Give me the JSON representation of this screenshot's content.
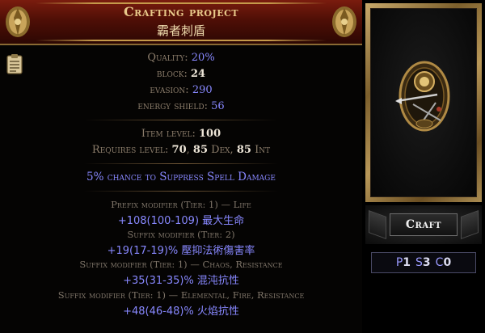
{
  "header": {
    "title": "Crafting project",
    "subtitle": "霸者刺盾"
  },
  "properties": {
    "quality": {
      "label": "Quality:",
      "value": "20%"
    },
    "block": {
      "label": "block:",
      "value": "24"
    },
    "evasion": {
      "label": "evasion:",
      "value": "290"
    },
    "energy_shield": {
      "label": "energy shield:",
      "value": "56"
    }
  },
  "requirements": {
    "item_level_label": "Item level:",
    "item_level": "100",
    "requires_label": "Requires level:",
    "level": "70",
    "dex": "85",
    "dex_label": "Dex,",
    "int": "85",
    "int_label": "Int"
  },
  "implicit": "5% chance to Suppress Spell Damage",
  "modifiers": [
    {
      "label": "Prefix modifier (Tier: 1) — Life",
      "value": "+108(100-109) 最大生命"
    },
    {
      "label": "Suffix modifier (Tier: 2)",
      "value": "+19(17-19)% 壓抑法術傷害率"
    },
    {
      "label": "Suffix modifier (Tier: 1) — Chaos, Resistance",
      "value": "+35(31-35)% 混沌抗性"
    },
    {
      "label": "Suffix modifier (Tier: 1) — Elemental, Fire, Resistance",
      "value": "+48(46-48)% 火焰抗性"
    }
  ],
  "craft_button": "Craft",
  "sockets": {
    "p_label": "P",
    "p_value": "1",
    "s_label": "S",
    "s_value": "3",
    "c_label": "C",
    "c_value": "0"
  },
  "colors": {
    "header_red": "#7a1c0e",
    "title_gold": "#e8c98a",
    "magic_blue": "#8888ff",
    "label_grey": "#8c7d6b",
    "frame_gold": "#c8a96b"
  },
  "icons": [
    "ornament-icon",
    "clipboard-icon",
    "shield-item-icon"
  ]
}
